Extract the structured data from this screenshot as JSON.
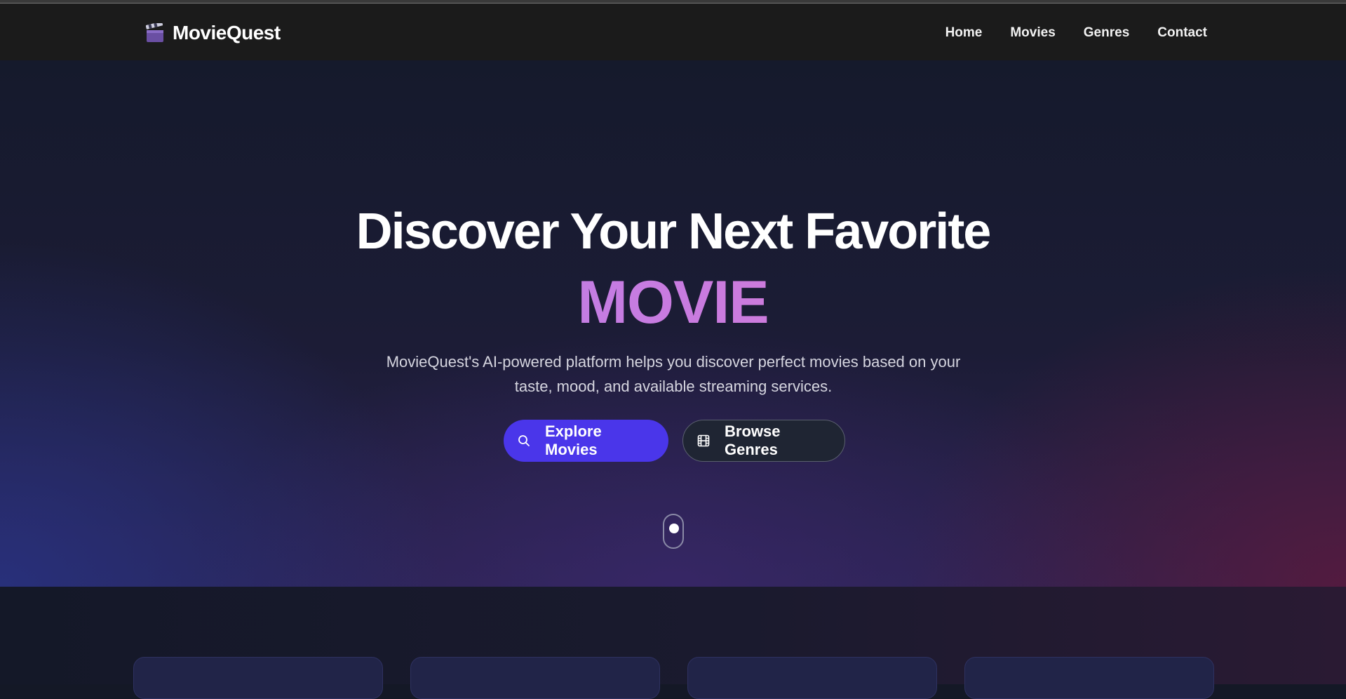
{
  "brand": {
    "name": "MovieQuest",
    "icon": "clapperboard-icon"
  },
  "nav": {
    "home": "Home",
    "movies": "Movies",
    "genres": "Genres",
    "contact": "Contact"
  },
  "hero": {
    "title": "Discover Your Next Favorite",
    "accent": "MOVIE",
    "subtitle_line1": "MovieQuest's AI-powered platform helps you discover perfect movies based on your",
    "subtitle_line2": "taste, mood, and available streaming services.",
    "primary_button": {
      "label": "Explore Movies",
      "icon": "search-icon"
    },
    "secondary_button": {
      "label": "Browse Genres",
      "icon": "film-icon"
    }
  },
  "colors": {
    "navbar": "#1b1b1b",
    "primary": "#4a36ea",
    "accent_gradient_start": "#a98af0",
    "accent_gradient_end": "#e57ac8"
  }
}
